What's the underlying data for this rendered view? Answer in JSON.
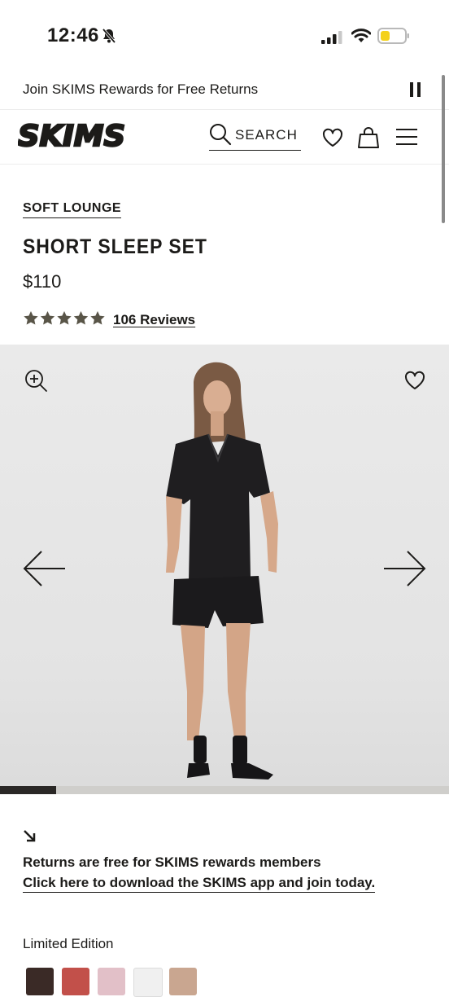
{
  "status_bar": {
    "time": "12:46",
    "icons": [
      "bell-slash-icon",
      "cell-signal-icon",
      "wifi-icon",
      "battery-low-icon"
    ]
  },
  "promo": {
    "text": "Join SKIMS Rewards for Free Returns",
    "pause_icon": "pause-icon"
  },
  "header": {
    "logo": "SKIMS",
    "search_label": "SEARCH",
    "icons": [
      "search-icon",
      "heart-icon",
      "bag-icon",
      "menu-icon"
    ]
  },
  "product": {
    "category": "SOFT LOUNGE",
    "title": "SHORT SLEEP SET",
    "price": "$110",
    "rating": 5,
    "reviews_label": "106 Reviews"
  },
  "gallery": {
    "icons": [
      "zoom-in-icon",
      "heart-icon",
      "arrow-left-icon",
      "arrow-right-icon"
    ],
    "progress": 0.125
  },
  "info": {
    "returns_text": "Returns are free for SKIMS rewards members",
    "app_link": "Click here to download the SKIMS app and join today."
  },
  "colors": {
    "label": "Limited Edition",
    "swatches": [
      "#3a2a26",
      "#c2504a",
      "#e2c0c8",
      "#f0f0f0",
      "#c9a690"
    ]
  },
  "theme": {
    "text": "#1c1b19",
    "star": "#595548"
  }
}
